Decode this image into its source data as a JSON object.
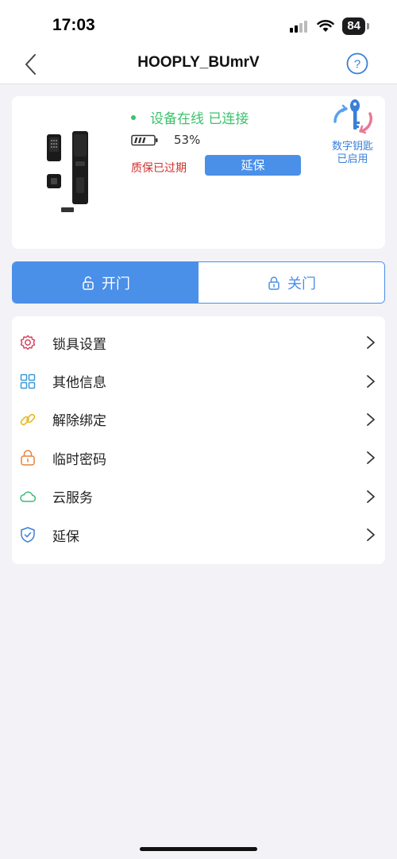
{
  "status_bar": {
    "time": "17:03",
    "battery": "84"
  },
  "nav": {
    "title": "HOOPLY_BUmrV"
  },
  "device": {
    "online_status": "设备在线 已连接",
    "battery_percent": "53%",
    "battery_level": 0.53,
    "warranty_status": "质保已过期",
    "extend_label": "延保",
    "digital_key_line1": "数字钥匙",
    "digital_key_line2": "已启用"
  },
  "door": {
    "open_label": "开门",
    "close_label": "关门",
    "active": "open"
  },
  "menu": {
    "items": [
      {
        "label": "锁具设置",
        "icon": "gear-icon",
        "color": "#d9455f"
      },
      {
        "label": "其他信息",
        "icon": "grid-icon",
        "color": "#3d9ad9"
      },
      {
        "label": "解除绑定",
        "icon": "link-icon",
        "color": "#e8b620"
      },
      {
        "label": "临时密码",
        "icon": "lock-icon",
        "color": "#e8833a"
      },
      {
        "label": "云服务",
        "icon": "cloud-icon",
        "color": "#3cb878"
      },
      {
        "label": "延保",
        "icon": "shield-icon",
        "color": "#3a7fd8"
      }
    ]
  },
  "colors": {
    "accent": "#4a8fe8",
    "online": "#3cc26a",
    "expired": "#d0302b"
  }
}
